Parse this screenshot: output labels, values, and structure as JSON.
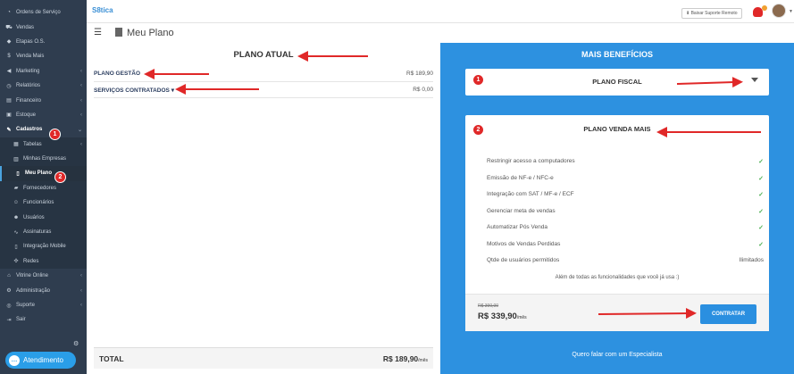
{
  "sidebar": {
    "items": [
      {
        "icon": "speedometer-icon",
        "label": "Ordens de Serviço",
        "chev": false
      },
      {
        "icon": "cart-icon",
        "label": "Vendas",
        "chev": false
      },
      {
        "icon": "tag-icon",
        "label": "Etapas O.S.",
        "chev": false
      },
      {
        "icon": "dollar-icon",
        "label": "Venda Mais",
        "chev": false
      },
      {
        "icon": "megaphone-icon",
        "label": "Marketing",
        "chev": true
      },
      {
        "icon": "clock-icon",
        "label": "Relatórios",
        "chev": true
      },
      {
        "icon": "money-icon",
        "label": "Financeiro",
        "chev": true
      },
      {
        "icon": "box-icon",
        "label": "Estoque",
        "chev": true
      },
      {
        "icon": "edit-icon",
        "label": "Cadastros",
        "chev": true,
        "active": true
      }
    ],
    "cadastros_sub": [
      {
        "icon": "table-icon",
        "label": "Tabelas",
        "chev": true
      },
      {
        "icon": "building-icon",
        "label": "Minhas Empresas",
        "chev": false
      },
      {
        "icon": "file-icon",
        "label": "Meu Plano",
        "chev": false,
        "current": true
      },
      {
        "icon": "truck-icon",
        "label": "Fornecedores",
        "chev": false
      },
      {
        "icon": "users-icon",
        "label": "Funcionários",
        "chev": false
      },
      {
        "icon": "user-icon",
        "label": "Usuários",
        "chev": false
      },
      {
        "icon": "signature-icon",
        "label": "Assinaturas",
        "chev": false
      },
      {
        "icon": "mobile-icon",
        "label": "Integração Mobile",
        "chev": false
      },
      {
        "icon": "network-icon",
        "label": "Redes",
        "chev": false
      }
    ],
    "bottom_items": [
      {
        "icon": "storefront-icon",
        "label": "Vitrine Online",
        "chev": true
      },
      {
        "icon": "cogs-icon",
        "label": "Administração",
        "chev": true
      },
      {
        "icon": "lifebuoy-icon",
        "label": "Suporte",
        "chev": true
      },
      {
        "icon": "logout-icon",
        "label": "Sair",
        "chev": false
      }
    ],
    "atendimento_label": "Atendimento",
    "annotation_1": "1",
    "annotation_2": "2"
  },
  "topbar": {
    "logo_text": "S8tica",
    "remote_support_label": "Baixar Suporte Remoto"
  },
  "header": {
    "page_title": "Meu Plano"
  },
  "left_panel": {
    "title": "PLANO ATUAL",
    "rows": [
      {
        "label": "PLANO GESTÃO",
        "value": "R$ 189,90"
      },
      {
        "label": "SERVIÇOS CONTRATADOS",
        "value": "R$ 0,00"
      }
    ],
    "total_label": "TOTAL",
    "total_value": "R$ 189,90",
    "total_unit": "/mês"
  },
  "right_panel": {
    "title": "MAIS BENEFÍCIOS",
    "card1": {
      "badge": "1",
      "title": "PLANO FISCAL"
    },
    "card2": {
      "badge": "2",
      "title": "PLANO VENDA MAIS",
      "features": [
        {
          "label": "Restringir acesso a computadores",
          "value": "✓"
        },
        {
          "label": "Emissão de NF-e / NFC-e",
          "value": "✓"
        },
        {
          "label": "Integração com SAT / MF-e / ECF",
          "value": "✓"
        },
        {
          "label": "Gerenciar meta de vendas",
          "value": "✓"
        },
        {
          "label": "Automatizar Pós Venda",
          "value": "✓"
        },
        {
          "label": "Motivos de Vendas Perdidas",
          "value": "✓"
        },
        {
          "label": "Qtde de usuários permitidos",
          "value": "Ilimitados"
        }
      ],
      "note": "Além de todas as funcionalidades que você já usa :)",
      "old_price": "R$ 390,00",
      "new_price": "R$ 339,90",
      "price_unit": "/mês",
      "cta_label": "CONTRATAR"
    },
    "especialista_label": "Quero falar com um Especialista"
  },
  "colors": {
    "sidebar_bg": "#2f3d4f",
    "accent_blue": "#2d91e0",
    "annotation_red": "#e02828",
    "check_green": "#4caf50"
  }
}
